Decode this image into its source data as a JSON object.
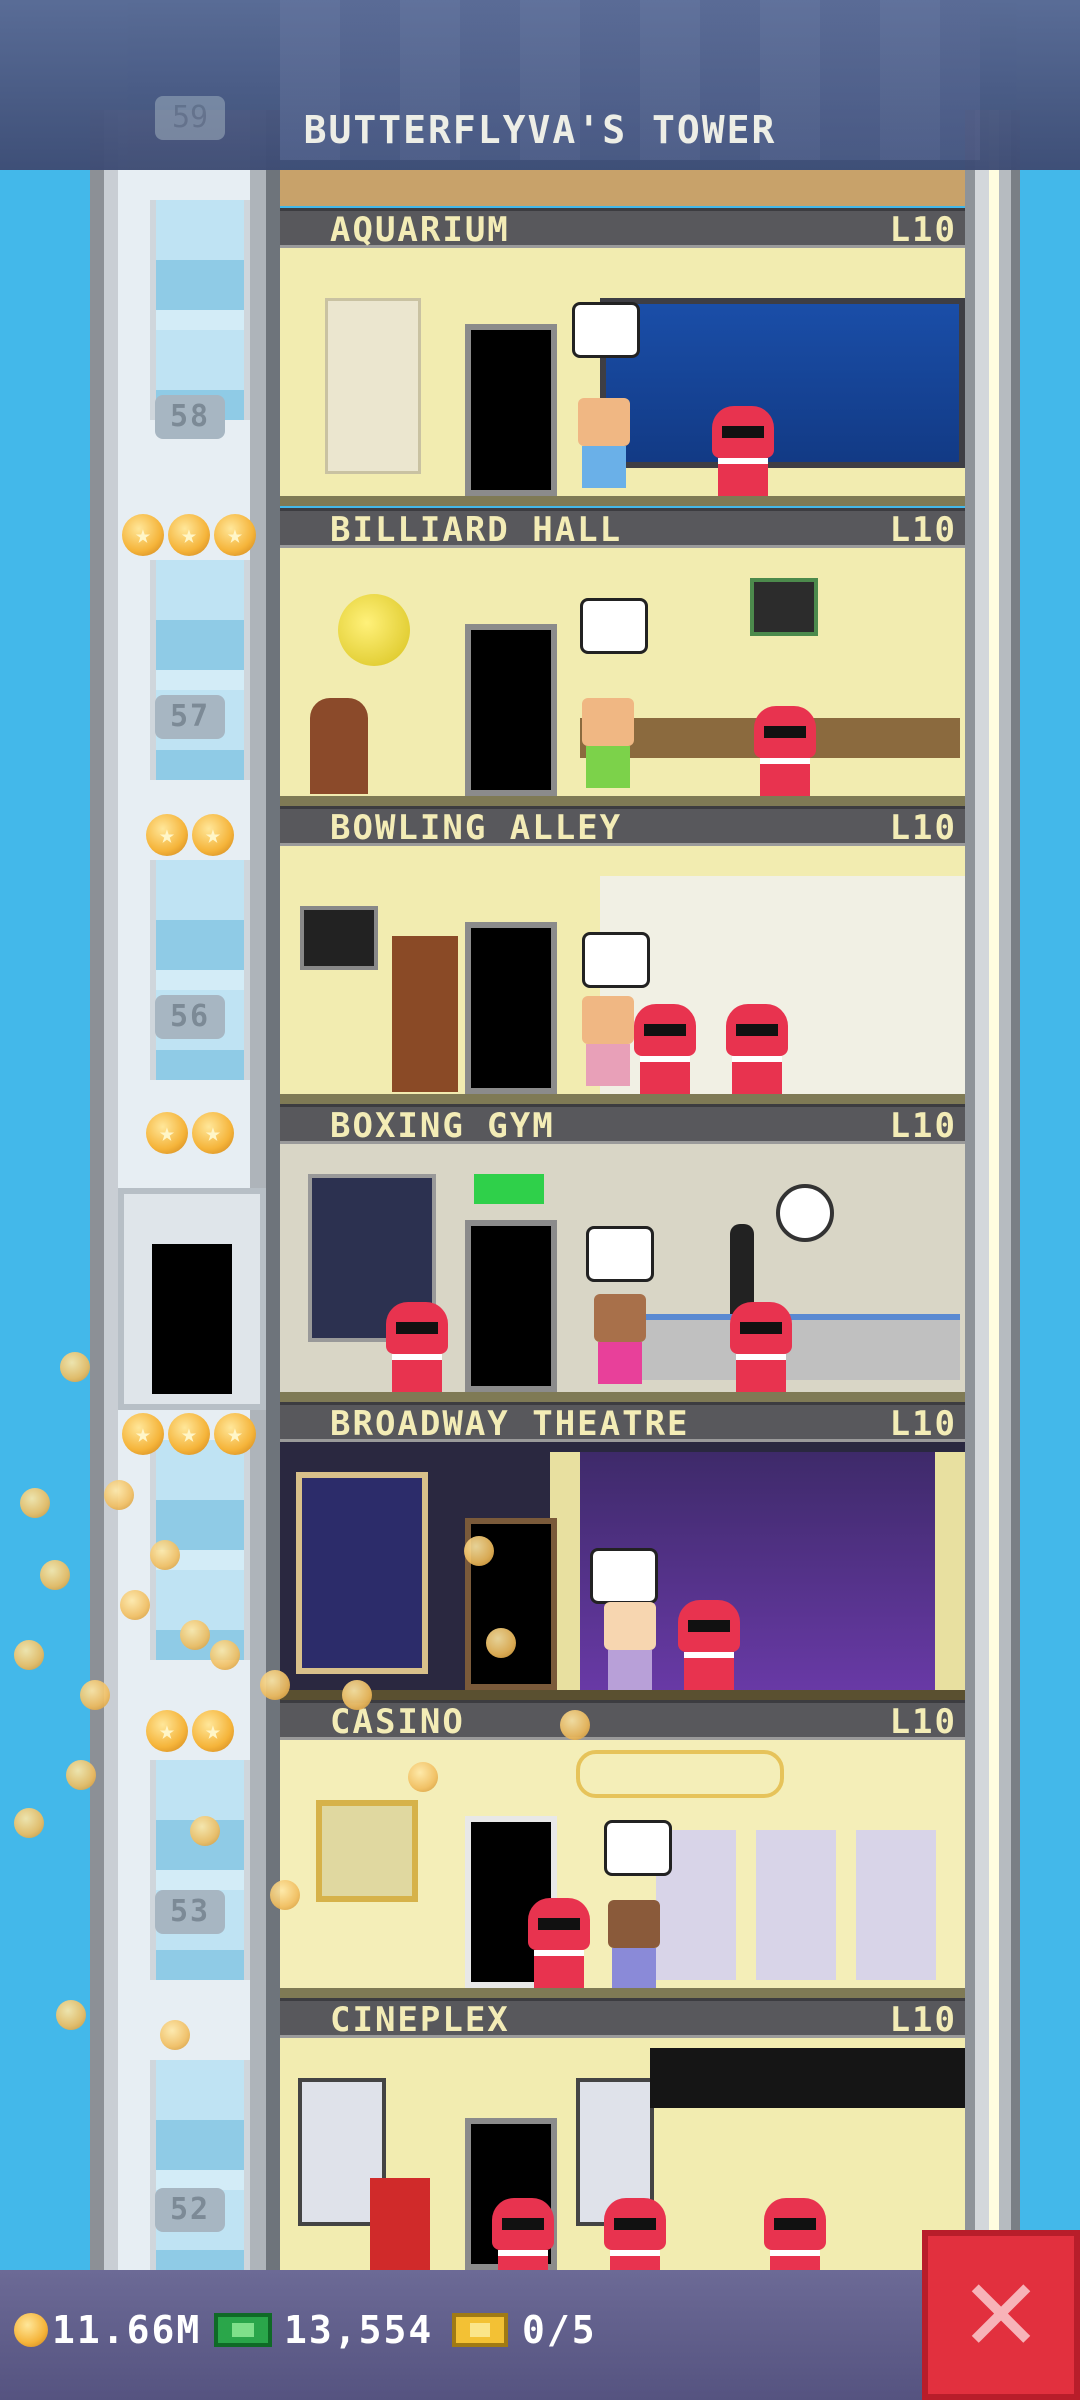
{
  "tower": {
    "title": "BUTTERFLYVA'S TOWER"
  },
  "floors": [
    {
      "name": "AQUARIUM",
      "level": "L10",
      "number": "58",
      "stars": 3
    },
    {
      "name": "BILLIARD HALL",
      "level": "L10",
      "number": "57",
      "stars": 2
    },
    {
      "name": "BOWLING ALLEY",
      "level": "L10",
      "number": "56",
      "stars": 2
    },
    {
      "name": "BOXING GYM",
      "level": "L10",
      "number": "",
      "stars": 3
    },
    {
      "name": "BROADWAY THEATRE",
      "level": "L10",
      "number": "",
      "stars": 2
    },
    {
      "name": "CASINO",
      "level": "L10",
      "number": "53",
      "stars": 0
    },
    {
      "name": "CINEPLEX",
      "level": "L10",
      "number": "52",
      "stars": 0
    }
  ],
  "top_floor_number": "59",
  "status": {
    "coins": "11.66M",
    "bux": "13,554",
    "tickets": "0/5"
  },
  "icons": {
    "coin": "coin-icon",
    "bux": "bux-icon",
    "ticket": "ticket-icon",
    "close": "close-icon",
    "star": "star-icon"
  },
  "colors": {
    "sky": "#43b8ea",
    "header_text": "#f3ecb6",
    "close_button": "#e2303e"
  }
}
